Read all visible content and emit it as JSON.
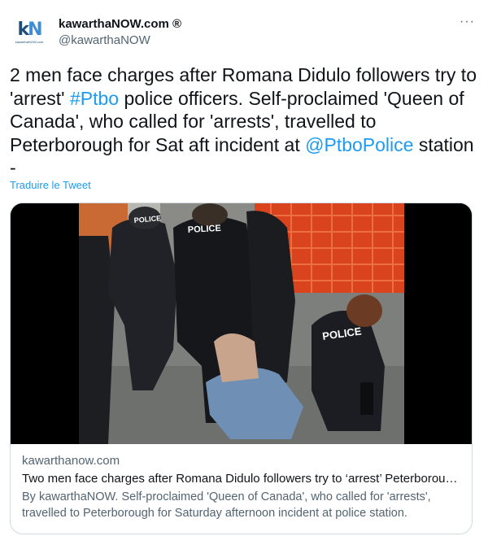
{
  "account": {
    "display_name": "kawarthaNOW.com ®",
    "handle": "@kawarthaNOW",
    "avatar_text": "kN",
    "avatar_subtext": "kawarthaNOW.com"
  },
  "tweet": {
    "segments": [
      "2 men face charges after Romana Didulo followers try to 'arrest' ",
      "#Ptbo",
      " police officers. Self-proclaimed 'Queen of Canada', who called for 'arrests', travelled to Peterborough for Sat aft incident at ",
      "@PtboPolice",
      " station -"
    ],
    "translate_label": "Traduire le Tweet",
    "more_label": "···"
  },
  "card": {
    "domain": "kawarthanow.com",
    "title": "Two men face charges after Romana Didulo followers try to ‘arrest’ Peterborough police officers",
    "description": "By kawarthaNOW. Self-proclaimed 'Queen of Canada', who called for 'arrests', travelled to Peterborough for Saturday afternoon incident at police station.",
    "image_labels": [
      "POLICE",
      "POLICE",
      "POLICE"
    ]
  },
  "colors": {
    "link": "#1d9bf0",
    "secondary_text": "#536471",
    "border": "#cfd9de"
  }
}
